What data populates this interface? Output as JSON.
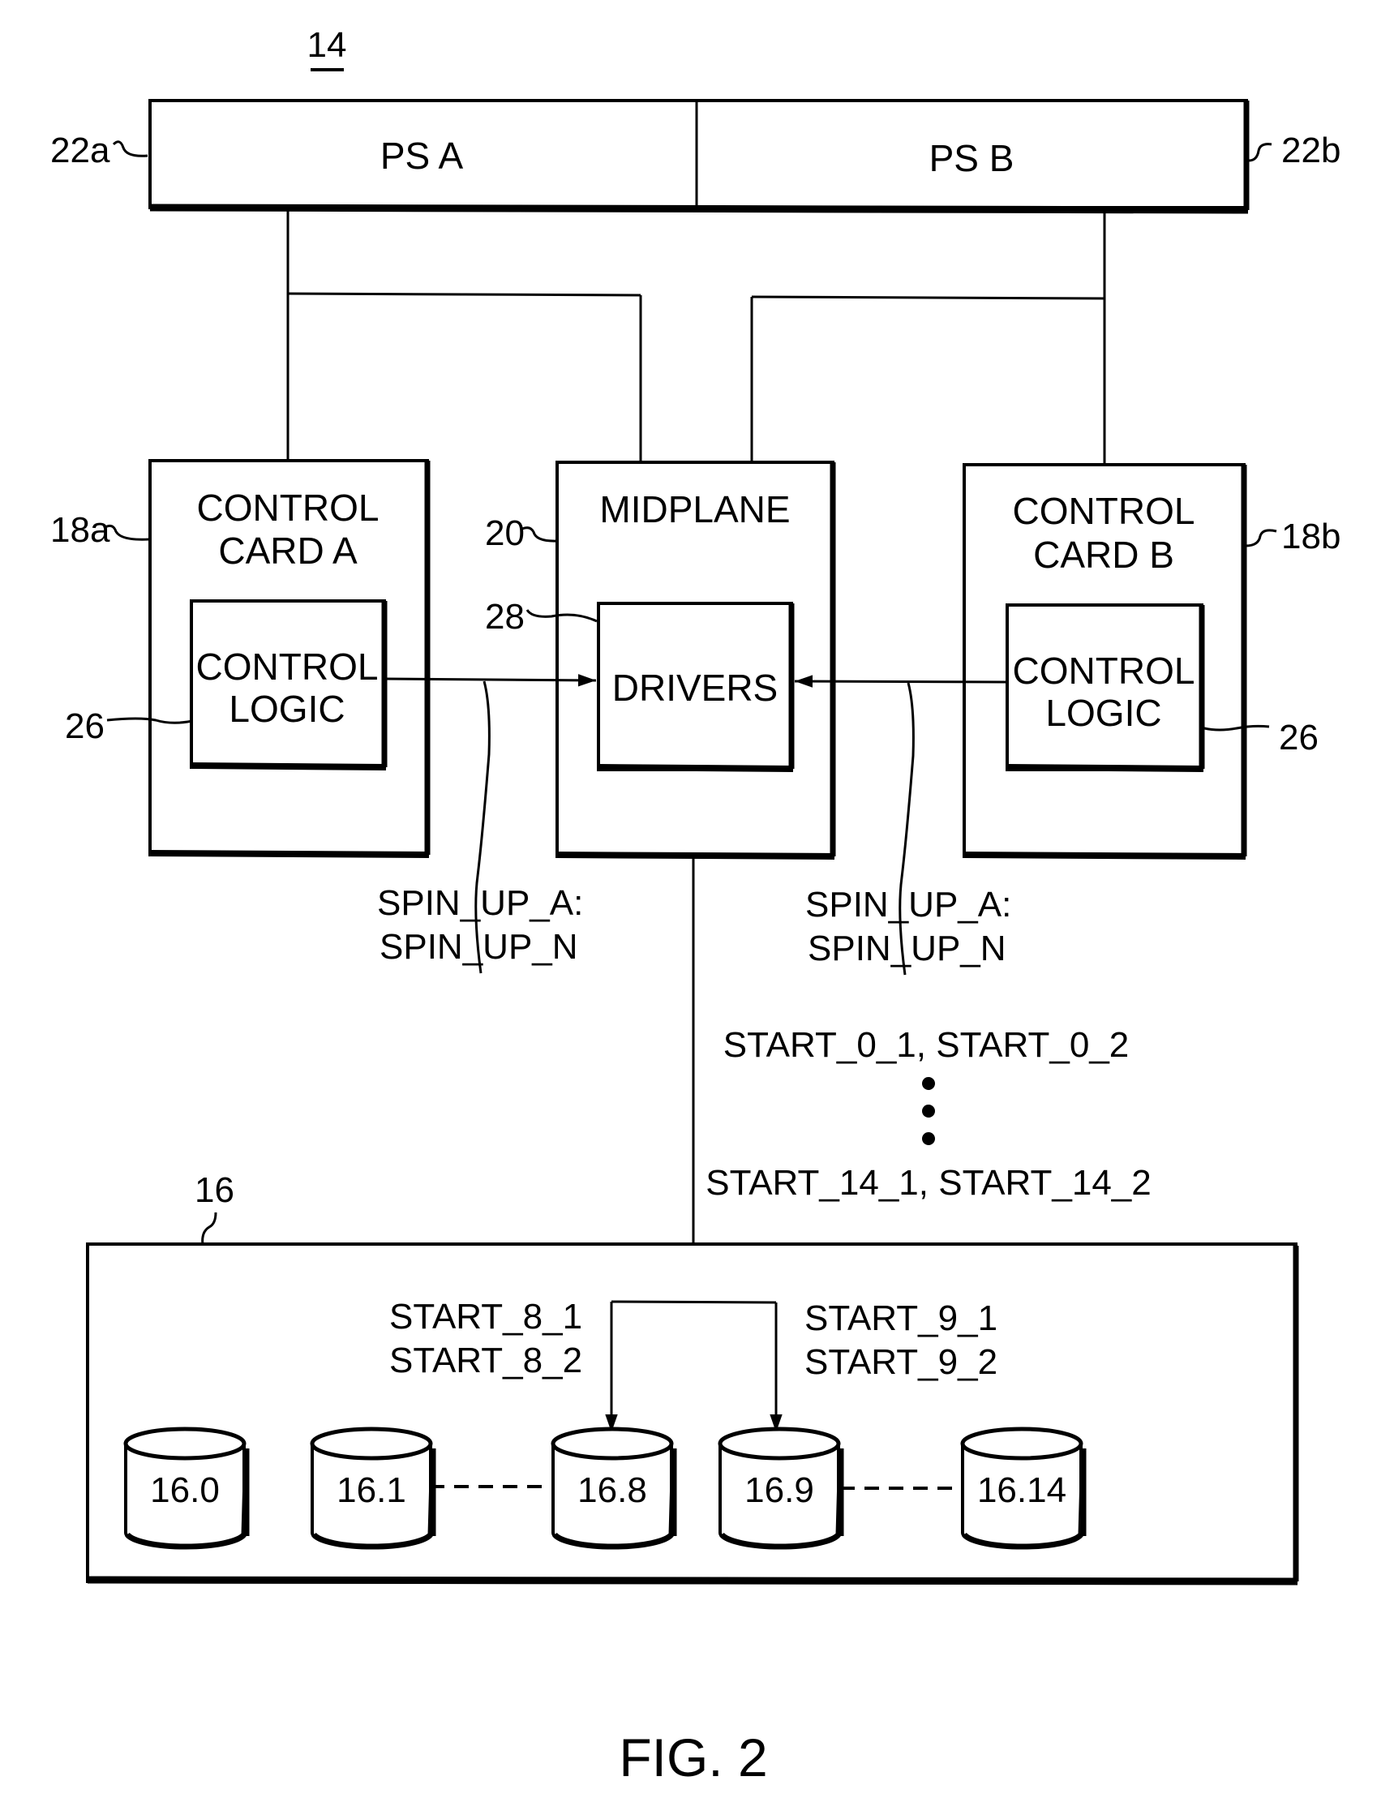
{
  "figure": {
    "ref_number": "14",
    "caption": "FIG. 2"
  },
  "power_supplies": {
    "a": {
      "label": "PS A",
      "ref": "22a"
    },
    "b": {
      "label": "PS B",
      "ref": "22b"
    }
  },
  "control_card_a": {
    "title_line1": "CONTROL",
    "title_line2": "CARD A",
    "ref": "18a",
    "logic": {
      "line1": "CONTROL",
      "line2": "LOGIC",
      "ref": "26"
    }
  },
  "midplane": {
    "title": "MIDPLANE",
    "ref": "20",
    "drivers": {
      "label": "DRIVERS",
      "ref": "28"
    }
  },
  "control_card_b": {
    "title_line1": "CONTROL",
    "title_line2": "CARD B",
    "ref": "18b",
    "logic": {
      "line1": "CONTROL",
      "line2": "LOGIC",
      "ref": "26"
    }
  },
  "signals": {
    "left_bus": {
      "line1": "SPIN_UP_A:",
      "line2": "SPIN_UP_N"
    },
    "right_bus": {
      "line1": "SPIN_UP_A:",
      "line2": "SPIN_UP_N"
    },
    "start_first": "START_0_1, START_0_2",
    "start_last": "START_14_1, START_14_2",
    "start_8": {
      "line1": "START_8_1",
      "line2": "START_8_2"
    },
    "start_9": {
      "line1": "START_9_1",
      "line2": "START_9_2"
    }
  },
  "disk_array": {
    "ref": "16",
    "disks": [
      {
        "label": "16.0"
      },
      {
        "label": "16.1"
      },
      {
        "label": "16.8"
      },
      {
        "label": "16.9"
      },
      {
        "label": "16.14"
      }
    ]
  }
}
